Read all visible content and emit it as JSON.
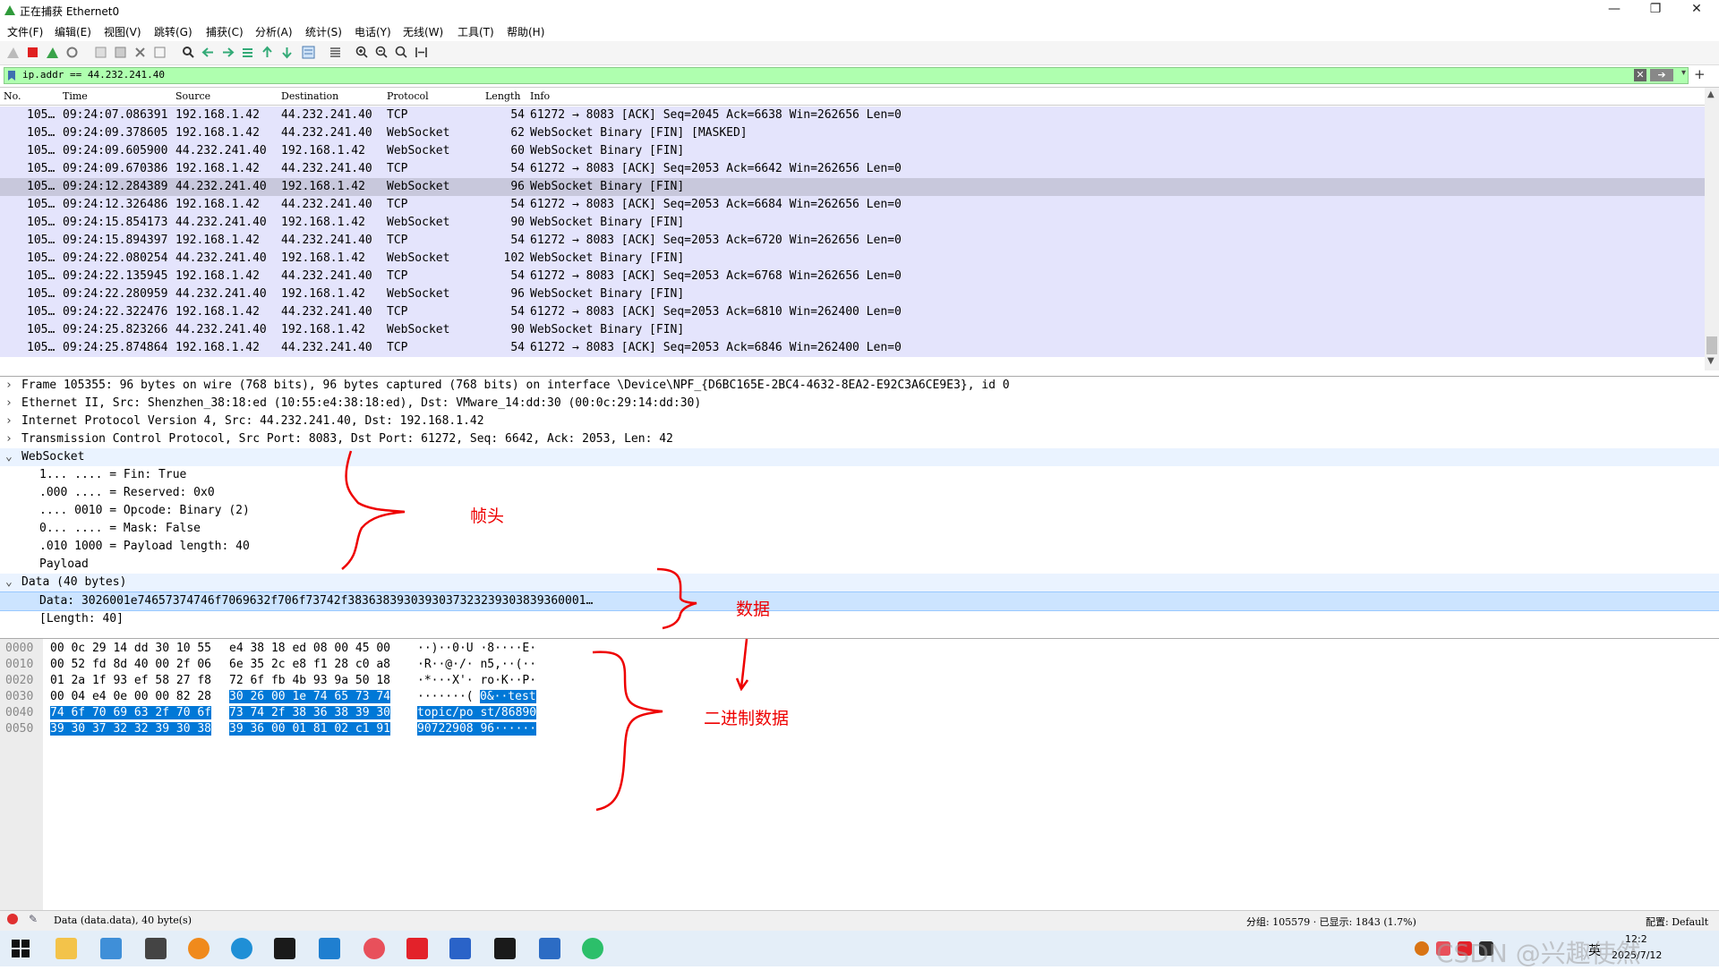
{
  "window": {
    "title": "正在捕获 Ethernet0",
    "controls": {
      "minimize": "—",
      "maximize": "❐",
      "close": "✕"
    }
  },
  "menu": [
    "文件(F)",
    "编辑(E)",
    "视图(V)",
    "跳转(G)",
    "捕获(C)",
    "分析(A)",
    "统计(S)",
    "电话(Y)",
    "无线(W)",
    "工具(T)",
    "帮助(H)"
  ],
  "filter": {
    "value": "ip.addr == 44.232.241.40"
  },
  "packet_list": {
    "columns": [
      "No.",
      "Time",
      "Source",
      "Destination",
      "Protocol",
      "Length",
      "Info"
    ],
    "rows": [
      {
        "no": "105…",
        "time": "09:24:07.086391",
        "src": "192.168.1.42",
        "dst": "44.232.241.40",
        "proto": "TCP",
        "len": "54",
        "info": "61272 → 8083 [ACK] Seq=2045 Ack=6638 Win=262656 Len=0"
      },
      {
        "no": "105…",
        "time": "09:24:09.378605",
        "src": "192.168.1.42",
        "dst": "44.232.241.40",
        "proto": "WebSocket",
        "len": "62",
        "info": "WebSocket Binary [FIN] [MASKED]"
      },
      {
        "no": "105…",
        "time": "09:24:09.605900",
        "src": "44.232.241.40",
        "dst": "192.168.1.42",
        "proto": "WebSocket",
        "len": "60",
        "info": "WebSocket Binary [FIN]"
      },
      {
        "no": "105…",
        "time": "09:24:09.670386",
        "src": "192.168.1.42",
        "dst": "44.232.241.40",
        "proto": "TCP",
        "len": "54",
        "info": "61272 → 8083 [ACK] Seq=2053 Ack=6642 Win=262656 Len=0"
      },
      {
        "no": "105…",
        "time": "09:24:12.284389",
        "src": "44.232.241.40",
        "dst": "192.168.1.42",
        "proto": "WebSocket",
        "len": "96",
        "info": "WebSocket Binary [FIN]"
      },
      {
        "no": "105…",
        "time": "09:24:12.326486",
        "src": "192.168.1.42",
        "dst": "44.232.241.40",
        "proto": "TCP",
        "len": "54",
        "info": "61272 → 8083 [ACK] Seq=2053 Ack=6684 Win=262656 Len=0"
      },
      {
        "no": "105…",
        "time": "09:24:15.854173",
        "src": "44.232.241.40",
        "dst": "192.168.1.42",
        "proto": "WebSocket",
        "len": "90",
        "info": "WebSocket Binary [FIN]"
      },
      {
        "no": "105…",
        "time": "09:24:15.894397",
        "src": "192.168.1.42",
        "dst": "44.232.241.40",
        "proto": "TCP",
        "len": "54",
        "info": "61272 → 8083 [ACK] Seq=2053 Ack=6720 Win=262656 Len=0"
      },
      {
        "no": "105…",
        "time": "09:24:22.080254",
        "src": "44.232.241.40",
        "dst": "192.168.1.42",
        "proto": "WebSocket",
        "len": "102",
        "info": "WebSocket Binary [FIN]"
      },
      {
        "no": "105…",
        "time": "09:24:22.135945",
        "src": "192.168.1.42",
        "dst": "44.232.241.40",
        "proto": "TCP",
        "len": "54",
        "info": "61272 → 8083 [ACK] Seq=2053 Ack=6768 Win=262656 Len=0"
      },
      {
        "no": "105…",
        "time": "09:24:22.280959",
        "src": "44.232.241.40",
        "dst": "192.168.1.42",
        "proto": "WebSocket",
        "len": "96",
        "info": "WebSocket Binary [FIN]"
      },
      {
        "no": "105…",
        "time": "09:24:22.322476",
        "src": "192.168.1.42",
        "dst": "44.232.241.40",
        "proto": "TCP",
        "len": "54",
        "info": "61272 → 8083 [ACK] Seq=2053 Ack=6810 Win=262400 Len=0"
      },
      {
        "no": "105…",
        "time": "09:24:25.823266",
        "src": "44.232.241.40",
        "dst": "192.168.1.42",
        "proto": "WebSocket",
        "len": "90",
        "info": "WebSocket Binary [FIN]"
      },
      {
        "no": "105…",
        "time": "09:24:25.874864",
        "src": "192.168.1.42",
        "dst": "44.232.241.40",
        "proto": "TCP",
        "len": "54",
        "info": "61272 → 8083 [ACK] Seq=2053 Ack=6846 Win=262400 Len=0"
      }
    ]
  },
  "detail": {
    "frame": "Frame 105355: 96 bytes on wire (768 bits), 96 bytes captured (768 bits) on interface \\Device\\NPF_{D6BC165E-2BC4-4632-8EA2-E92C3A6CE9E3}, id 0",
    "ethernet": "Ethernet II, Src: Shenzhen_38:18:ed (10:55:e4:38:18:ed), Dst: VMware_14:dd:30 (00:0c:29:14:dd:30)",
    "ip": "Internet Protocol Version 4, Src: 44.232.241.40, Dst: 192.168.1.42",
    "tcp": "Transmission Control Protocol, Src Port: 8083, Dst Port: 61272, Seq: 6642, Ack: 2053, Len: 42",
    "websocket": "WebSocket",
    "ws_fin": "1... .... = Fin: True",
    "ws_reserved": ".000 .... = Reserved: 0x0",
    "ws_opcode": ".... 0010 = Opcode: Binary (2)",
    "ws_mask": "0... .... = Mask: False",
    "ws_len": ".010 1000 = Payload length: 40",
    "ws_payload": "Payload",
    "data": "Data (40 bytes)",
    "data_value": "Data: 3026001e74657374746f7069632f706f73742f3836383930393037323239303839360001…",
    "data_length": "[Length: 40]"
  },
  "bytes": [
    {
      "off": "0000",
      "hex_a": "00 0c 29 14 dd 30 10 55",
      "hex_b": "e4 38 18 ed 08 00 45 00",
      "ascii": "··)··0·U ·8····E·"
    },
    {
      "off": "0010",
      "hex_a": "00 52 fd 8d 40 00 2f 06",
      "hex_b": "6e 35 2c e8 f1 28 c0 a8",
      "ascii": "·R··@·/· n5,··(··"
    },
    {
      "off": "0020",
      "hex_a": "01 2a 1f 93 ef 58 27 f8",
      "hex_b": "72 6f fb 4b 93 9a 50 18",
      "ascii": "·*···X'· ro·K··P·"
    },
    {
      "off": "0030",
      "hex_a": "00 04 e4 0e 00 00 82 28",
      "hex_b_plain": "",
      "hex_b": "30 26 00 1e 74 65 73 74",
      "ascii_plain": "·······(",
      "ascii": "0&··test"
    },
    {
      "off": "0040",
      "hex_a": "74 6f 70 69 63 2f 70 6f",
      "hex_b": "73 74 2f 38 36 38 39 30",
      "ascii": "topic/po st/86890"
    },
    {
      "off": "0050",
      "hex_a": "39 30 37 32 32 39 30 38",
      "hex_b": "39 36 00 01 81 02 c1 91",
      "ascii": "90722908 96······"
    }
  ],
  "status": {
    "left": "Data (data.data), 40 byte(s)",
    "right": "分组: 105579 · 已显示: 1843 (1.7%)",
    "profile": "配置: Default"
  },
  "annotations": {
    "header": "帧头",
    "data": "数据",
    "binary": "二进制数据"
  },
  "taskbar": {
    "lang": "英",
    "time": "12:2",
    "date": "2025/7/12",
    "watermark": "CSDN @兴趣使然"
  }
}
